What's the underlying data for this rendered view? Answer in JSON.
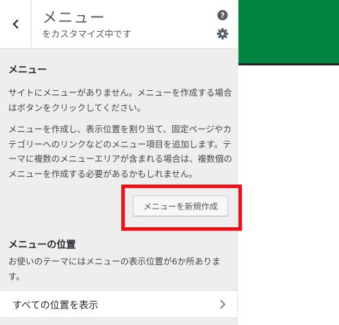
{
  "header": {
    "title": "メニュー",
    "subtitle": "をカスタマイズ中です",
    "icons": {
      "back": "chevron-left-icon",
      "help": "help-icon",
      "settings": "gear-icon"
    }
  },
  "menu_section": {
    "heading": "メニュー",
    "no_menu_text": "サイトにメニューがありません。メニューを作成する場合はボタンをクリックしてください。",
    "description": "メニューを作成し、表示位置を割り当て、固定ページやカテゴリーへのリンクなどのメニュー項目を追加します。テーマに複数のメニューエリアが含まれる場合は、複数個のメニューを作成する必要があるかもしれません。",
    "create_button": "メニューを新規作成"
  },
  "locations_section": {
    "heading": "メニューの位置",
    "description": "お使いのテーマにはメニューの表示位置が6か所あります。",
    "view_all": "すべての位置を表示"
  },
  "colors": {
    "preview_green": "#008440",
    "highlight_red": "#e3151b"
  }
}
